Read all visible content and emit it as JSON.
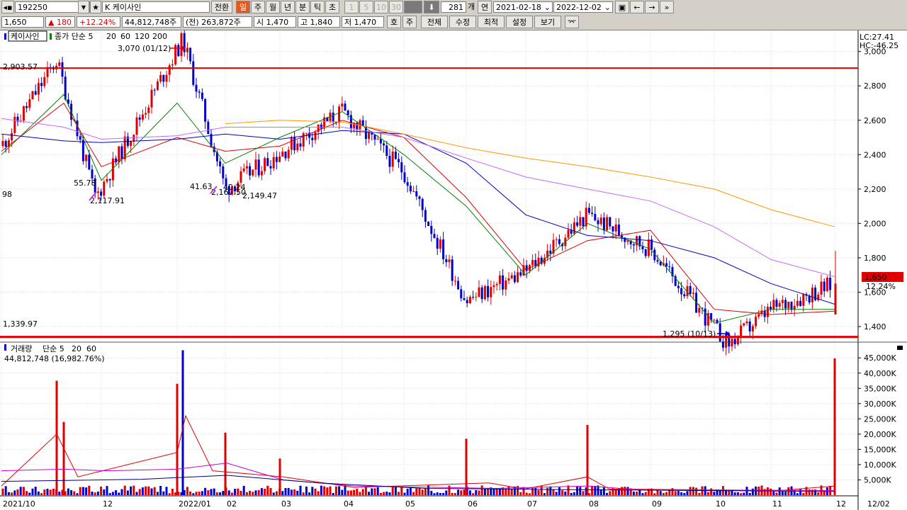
{
  "toolbar": {
    "code": "192250",
    "name": "K 케이사인",
    "convert_label": "전환",
    "periods": [
      "일",
      "주",
      "월",
      "년",
      "분",
      "틱",
      "초"
    ],
    "active_period": "일",
    "ticks": [
      "1",
      "5",
      "10",
      "30"
    ],
    "count": "281",
    "count_unit": "개",
    "date_toggle": "연",
    "date_from": "2021-02-18",
    "date_to": "2022-12-02"
  },
  "quote": {
    "price": "1,650",
    "change": "180",
    "change_pct": "+12.24%",
    "volume": "44,812,748주",
    "prev_volume": "(전) 263,872주",
    "open": "시 1,470",
    "high": "고 1,840",
    "low": "저 1,470",
    "buttons": [
      "호",
      "주",
      "전체",
      "수정",
      "최적",
      "설정",
      "보기"
    ]
  },
  "price_panel": {
    "legend_name": "케이사인",
    "legend_ma": [
      "종가 단순 5",
      "20",
      "60",
      "120",
      "200"
    ],
    "lc": "LC:27.41",
    "hc": "HC:-46.25",
    "current_price_label": "1,650",
    "current_pct_label": "12.24%",
    "resist_label": "2,903.57",
    "support_label": "1,339.97",
    "left_edge_label": "98",
    "max_annotation": "3,070 (01/12)",
    "min_annotation": "1,295 (10/13)",
    "annot_texts": [
      "55.78",
      "2,117.91",
      "41.63",
      "2,167.50",
      "40.24",
      "2,149.47"
    ]
  },
  "volume_panel": {
    "legend": [
      "거래량",
      "단순 5",
      "20",
      "60"
    ],
    "legend_value": "44,812,748 (16,982.76%)"
  },
  "chart_data": [
    {
      "type": "candlestick",
      "title": "케이사인",
      "x_ticks": [
        "2021/10",
        "12",
        "2022/01",
        "02",
        "03",
        "04",
        "05",
        "06",
        "07",
        "08",
        "09",
        "10",
        "11",
        "12",
        "12/02"
      ],
      "y_ticks": [
        1400,
        1600,
        1800,
        2000,
        2200,
        2400,
        2600,
        2800,
        3000
      ],
      "ylim": [
        1330,
        3110
      ],
      "grid": true,
      "key_points": [
        {
          "x": "2021/10",
          "close": 2450
        },
        {
          "x": "2021/10 mid",
          "close": 2950
        },
        {
          "x": "2021/11 end",
          "close": 2150
        },
        {
          "x": "2022/01/12",
          "high": 3070
        },
        {
          "x": "2022/02",
          "close": 2200
        },
        {
          "x": "2022/04",
          "close": 2650
        },
        {
          "x": "2022/05",
          "close": 2300
        },
        {
          "x": "2022/06",
          "close": 1550
        },
        {
          "x": "2022/07",
          "close": 1720
        },
        {
          "x": "2022/08",
          "close": 2050
        },
        {
          "x": "2022/09",
          "close": 1850
        },
        {
          "x": "2022/10/13",
          "low": 1295
        },
        {
          "x": "2022/11",
          "close": 1500
        },
        {
          "x": "2022/12/02",
          "open": 1470,
          "high": 1840,
          "low": 1470,
          "close": 1650
        }
      ],
      "reference_lines": [
        2903.57,
        1339.97
      ],
      "series": [
        {
          "name": "5",
          "color": "#008000"
        },
        {
          "name": "20",
          "color": "#e00000"
        },
        {
          "name": "60",
          "color": "#0000c0"
        },
        {
          "name": "120",
          "color": "#cc66ff"
        },
        {
          "name": "200",
          "color": "#ff9900"
        }
      ],
      "ma_points": {
        "5": [
          [
            "2021/10",
            2400
          ],
          [
            "2021/11",
            2750
          ],
          [
            "2021/12",
            2250
          ],
          [
            "2022/01",
            2700
          ],
          [
            "2022/02",
            2350
          ],
          [
            "2022/03",
            2500
          ],
          [
            "2022/04",
            2650
          ],
          [
            "2022/05",
            2400
          ],
          [
            "2022/06",
            2100
          ],
          [
            "2022/07",
            1700
          ],
          [
            "2022/08",
            2000
          ],
          [
            "2022/09",
            1850
          ],
          [
            "2022/10",
            1420
          ],
          [
            "2022/11",
            1500
          ],
          [
            "2022/12/02",
            1500
          ]
        ],
        "20": [
          [
            "2021/10",
            2420
          ],
          [
            "2021/11",
            2700
          ],
          [
            "2021/12",
            2330
          ],
          [
            "2022/01",
            2500
          ],
          [
            "2022/02",
            2420
          ],
          [
            "2022/03",
            2450
          ],
          [
            "2022/04",
            2600
          ],
          [
            "2022/05",
            2500
          ],
          [
            "2022/06",
            2150
          ],
          [
            "2022/07",
            1730
          ],
          [
            "2022/08",
            1900
          ],
          [
            "2022/09",
            1960
          ],
          [
            "2022/10",
            1500
          ],
          [
            "2022/11",
            1470
          ],
          [
            "2022/12/02",
            1490
          ]
        ],
        "60": [
          [
            "2021/10",
            2520
          ],
          [
            "2021/11",
            2480
          ],
          [
            "2021/12",
            2470
          ],
          [
            "2022/01",
            2490
          ],
          [
            "2022/02",
            2520
          ],
          [
            "2022/03",
            2490
          ],
          [
            "2022/04",
            2540
          ],
          [
            "2022/05",
            2520
          ],
          [
            "2022/06",
            2350
          ],
          [
            "2022/07",
            2050
          ],
          [
            "2022/08",
            1930
          ],
          [
            "2022/09",
            1900
          ],
          [
            "2022/10",
            1800
          ],
          [
            "2022/11",
            1650
          ],
          [
            "2022/12/02",
            1530
          ]
        ],
        "120": [
          [
            "2021/10",
            2610
          ],
          [
            "2021/11",
            2560
          ],
          [
            "2021/12",
            2490
          ],
          [
            "2022/01",
            2510
          ],
          [
            "2022/02",
            2560
          ],
          [
            "2022/03",
            2560
          ],
          [
            "2022/04",
            2560
          ],
          [
            "2022/05",
            2500
          ],
          [
            "2022/06",
            2380
          ],
          [
            "2022/07",
            2270
          ],
          [
            "2022/08",
            2200
          ],
          [
            "2022/09",
            2130
          ],
          [
            "2022/10",
            1980
          ],
          [
            "2022/11",
            1790
          ],
          [
            "2022/12/02",
            1690
          ]
        ],
        "200": [
          [
            "2022/02",
            2580
          ],
          [
            "2022/03",
            2600
          ],
          [
            "2022/04",
            2590
          ],
          [
            "2022/05",
            2520
          ],
          [
            "2022/06",
            2440
          ],
          [
            "2022/07",
            2380
          ],
          [
            "2022/08",
            2330
          ],
          [
            "2022/09",
            2270
          ],
          [
            "2022/10",
            2200
          ],
          [
            "2022/11",
            2080
          ],
          [
            "2022/12/02",
            1980
          ]
        ]
      }
    },
    {
      "type": "bar",
      "title": "거래량",
      "y_ticks": [
        5000,
        10000,
        15000,
        20000,
        25000,
        30000,
        35000,
        40000,
        45000
      ],
      "y_tick_labels": [
        "5,000K",
        "10,000K",
        "15,000K",
        "20,000K",
        "25,000K",
        "30,000K",
        "35,000K",
        "40,000K",
        "45,000K"
      ],
      "ylim": [
        0,
        49000
      ],
      "unit": "K",
      "spikes": [
        {
          "x": "2021/10 mid",
          "value": 37500,
          "color": "red"
        },
        {
          "x": "2021/11",
          "value": 24000,
          "color": "red"
        },
        {
          "x": "2022/01",
          "value": 36500,
          "color": "red"
        },
        {
          "x": "2022/01/12",
          "value": 47500,
          "color": "blue"
        },
        {
          "x": "2022/02",
          "value": 20500,
          "color": "red"
        },
        {
          "x": "2022/03",
          "value": 12000,
          "color": "red"
        },
        {
          "x": "2022/06",
          "value": 18500,
          "color": "red"
        },
        {
          "x": "2022/08",
          "value": 23000,
          "color": "red"
        },
        {
          "x": "2022/12/02",
          "value": 44812.748,
          "color": "red"
        }
      ],
      "ma_series": [
        {
          "name": "5",
          "color": "#e00000"
        },
        {
          "name": "20",
          "color": "#cc00cc"
        },
        {
          "name": "60",
          "color": "#000080"
        }
      ]
    }
  ],
  "colors": {
    "up": "#e00000",
    "down": "#0000c8",
    "resist_line": "#e00000",
    "support_line": "#e00000"
  }
}
